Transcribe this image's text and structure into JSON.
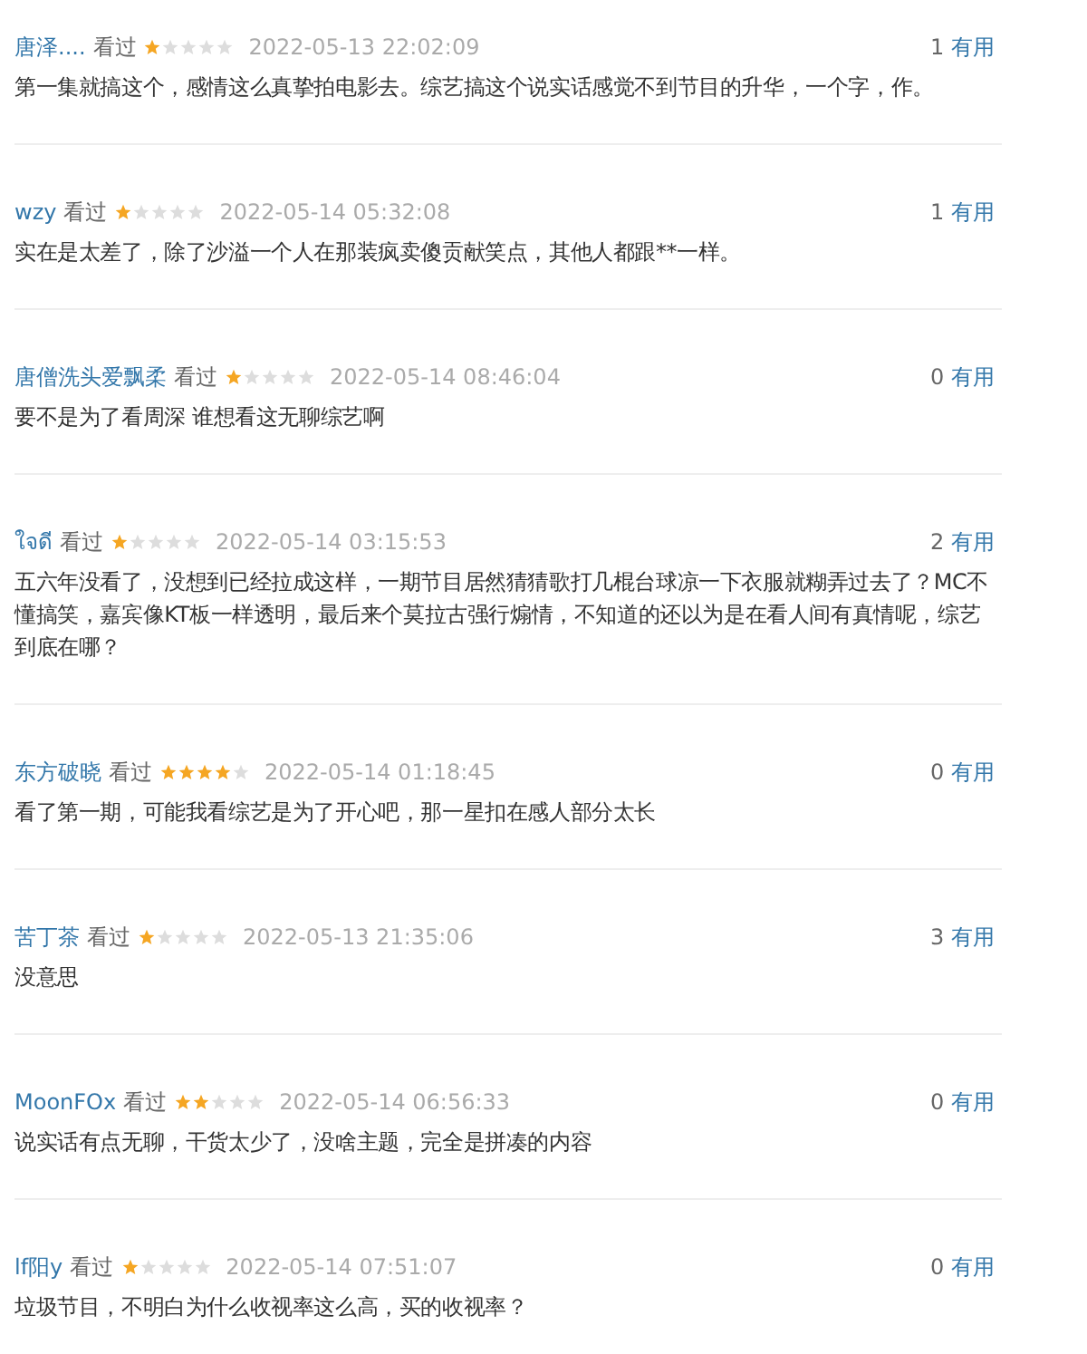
{
  "reviews": [
    {
      "user": "唐泽....",
      "status": "看过",
      "stars": 1,
      "time": "2022-05-13 22:02:09",
      "useful_count": "1",
      "useful_label": "有用",
      "text": "第一集就搞这个，感情这么真挚拍电影去。综艺搞这个说实话感觉不到节目的升华，一个字，作。"
    },
    {
      "user": "wzy",
      "status": "看过",
      "stars": 1,
      "time": "2022-05-14 05:32:08",
      "useful_count": "1",
      "useful_label": "有用",
      "text": "实在是太差了，除了沙溢一个人在那装疯卖傻贡献笑点，其他人都跟**一样。"
    },
    {
      "user": "唐僧洗头爱飘柔",
      "status": "看过",
      "stars": 1,
      "time": "2022-05-14 08:46:04",
      "useful_count": "0",
      "useful_label": "有用",
      "text": "要不是为了看周深 谁想看这无聊综艺啊"
    },
    {
      "user": "ใจดี",
      "status": "看过",
      "stars": 1,
      "time": "2022-05-14 03:15:53",
      "useful_count": "2",
      "useful_label": "有用",
      "text": "五六年没看了，没想到已经拉成这样，一期节目居然猜猜歌打几棍台球凉一下衣服就糊弄过去了？MC不懂搞笑，嘉宾像KT板一样透明，最后来个莫拉古强行煽情，不知道的还以为是在看人间有真情呢，综艺到底在哪？"
    },
    {
      "user": "东方破晓",
      "status": "看过",
      "stars": 4,
      "time": "2022-05-14 01:18:45",
      "useful_count": "0",
      "useful_label": "有用",
      "text": "看了第一期，可能我看综艺是为了开心吧，那一星扣在感人部分太长"
    },
    {
      "user": "苦丁茶",
      "status": "看过",
      "stars": 1,
      "time": "2022-05-13 21:35:06",
      "useful_count": "3",
      "useful_label": "有用",
      "text": "没意思"
    },
    {
      "user": "MoonFOx",
      "status": "看过",
      "stars": 2,
      "time": "2022-05-14 06:56:33",
      "useful_count": "0",
      "useful_label": "有用",
      "text": "说实话有点无聊，干货太少了，没啥主题，完全是拼凑的内容"
    },
    {
      "user": "lf阳y",
      "status": "看过",
      "stars": 1,
      "time": "2022-05-14 07:51:07",
      "useful_count": "0",
      "useful_label": "有用",
      "text": "垃圾节目，不明白为什么收视率这么高，买的收视率？"
    }
  ]
}
